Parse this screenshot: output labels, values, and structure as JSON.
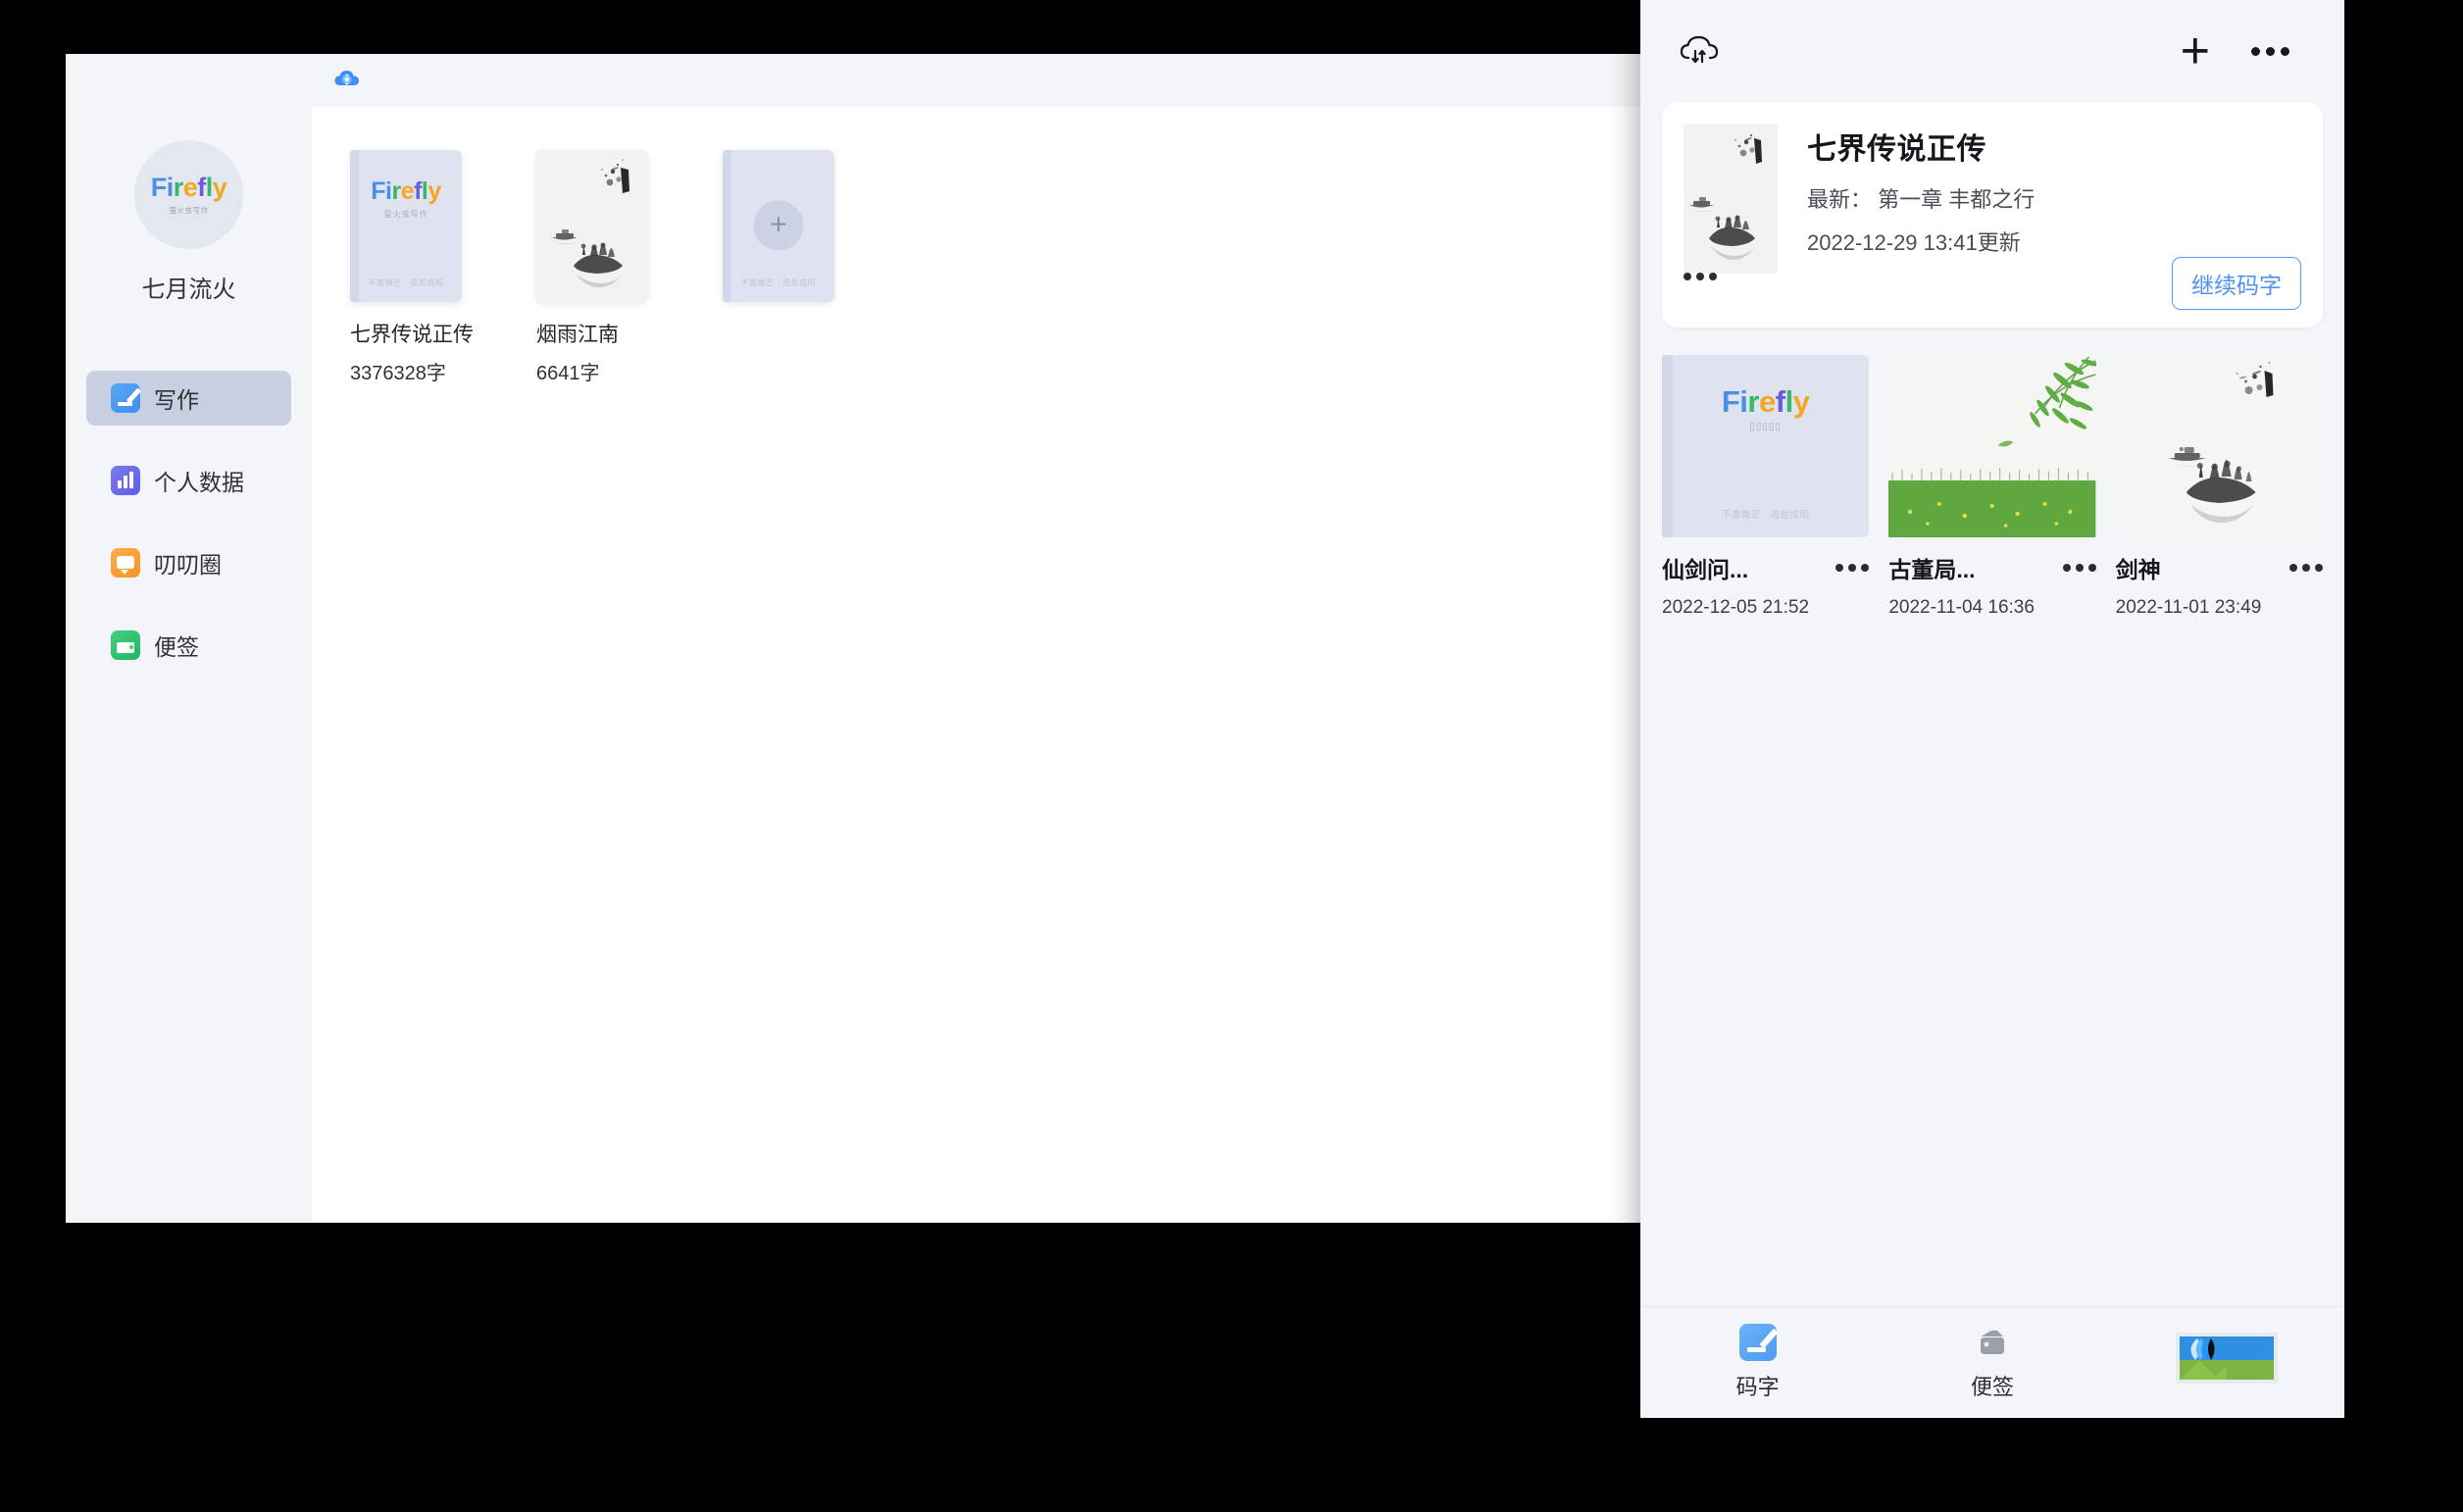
{
  "desktop": {
    "sidebar": {
      "avatar": {
        "logo_text": "Firefly",
        "logo_sub": "萤火虫写作"
      },
      "username": "七月流火",
      "items": [
        {
          "label": "写作",
          "icon": "write-icon",
          "active": true
        },
        {
          "label": "个人数据",
          "icon": "chart-icon",
          "active": false
        },
        {
          "label": "叨叨圈",
          "icon": "chat-icon",
          "active": false
        },
        {
          "label": "便签",
          "icon": "wallet-icon",
          "active": false
        }
      ]
    },
    "header": {
      "cloud_sync_icon": "cloud-sync-icon"
    },
    "books": [
      {
        "title": "七界传说正传",
        "words": "3376328字",
        "cover": "firefly",
        "tagline": "不畲微芒 · 造炬成阳"
      },
      {
        "title": "烟雨江南",
        "words": "6641字",
        "cover": "ink-landscape",
        "tagline": ""
      },
      {
        "title": "",
        "words": "",
        "cover": "add-new",
        "tagline": "不畲微芒 · 造炬成阳"
      }
    ]
  },
  "mobile": {
    "header": {
      "cloud_icon": "cloud-download-icon",
      "add_icon": "plus-icon",
      "more_icon": "more-horizontal-icon"
    },
    "feature": {
      "title": "七界传说正传",
      "latest": "最新： 第一章 丰都之行",
      "updated": "2022-12-29 13:41更新",
      "button_label": "继续码字",
      "more_icon": "more-horizontal-icon",
      "cover": "ink-landscape"
    },
    "books": [
      {
        "title": "仙剑问...",
        "time": "2022-12-05 21:52",
        "cover": "firefly",
        "tagline": "不畲微芒 · 造炬成阳",
        "more_icon": "more-horizontal-icon"
      },
      {
        "title": "古董局...",
        "time": "2022-11-04 16:36",
        "cover": "willow-grass",
        "tagline": "",
        "more_icon": "more-horizontal-icon"
      },
      {
        "title": "剑神",
        "time": "2022-11-01 23:49",
        "cover": "ink-landscape",
        "tagline": "",
        "more_icon": "more-horizontal-icon"
      }
    ],
    "tabs": [
      {
        "label": "码字",
        "icon": "write-icon",
        "active": true
      },
      {
        "label": "便签",
        "icon": "wallet-icon",
        "active": false
      },
      {
        "label": "",
        "icon": "image-thumb-icon",
        "active": false
      }
    ]
  },
  "colors": {
    "accent_blue": "#4d92f3",
    "sidebar_bg": "#f4f5f9",
    "active_nav": "#c8cfe0",
    "panel_bg": "#f4f5f8"
  }
}
